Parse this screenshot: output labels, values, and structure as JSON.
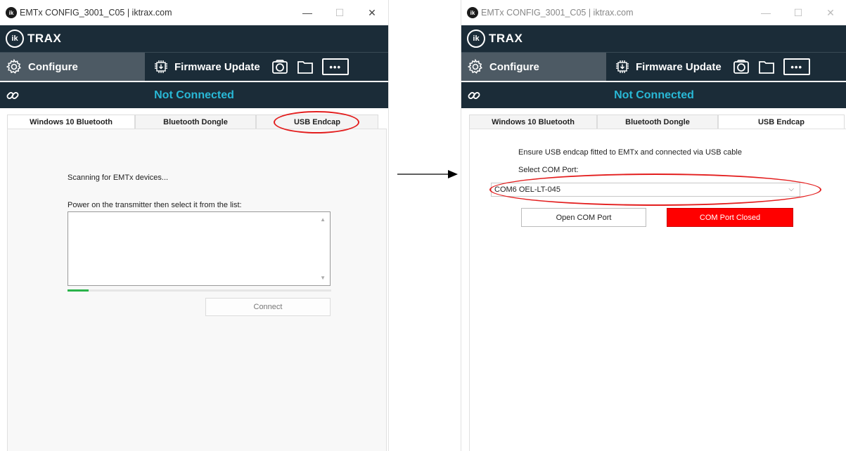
{
  "left_window": {
    "title": "EMTx CONFIG_3001_C05 | iktrax.com",
    "app_icon": "ik",
    "window_controls": {
      "minimize": "—",
      "maximize": "☐",
      "close": "✕"
    },
    "logo": {
      "mark": "ik",
      "text": "TRAX"
    },
    "nav": {
      "configure": "Configure",
      "firmware_update": "Firmware Update",
      "more": "•••"
    },
    "connection_status": "Not Connected",
    "tabs": [
      "Windows 10 Bluetooth",
      "Bluetooth Dongle",
      "USB Endcap"
    ],
    "active_tab": "Windows 10 Bluetooth",
    "scanning_text": "Scanning for EMTx devices...",
    "instruction": "Power on the transmitter then select it from the list:",
    "scan_progress": 0.08,
    "connect_label": "Connect"
  },
  "right_window": {
    "title": "EMTx CONFIG_3001_C05 | iktrax.com",
    "app_icon": "ik",
    "window_controls": {
      "minimize": "—",
      "maximize": "☐",
      "close": "✕"
    },
    "logo": {
      "mark": "ik",
      "text": "TRAX"
    },
    "nav": {
      "configure": "Configure",
      "firmware_update": "Firmware Update",
      "more": "•••"
    },
    "connection_status": "Not Connected",
    "tabs": [
      "Windows 10 Bluetooth",
      "Bluetooth Dongle",
      "USB Endcap"
    ],
    "active_tab": "USB Endcap",
    "ensure_text": "Ensure USB endcap fitted to EMTx and connected via USB cable",
    "select_label": "Select COM Port:",
    "com_port_value": "COM6 OEL-LT-045",
    "open_button": "Open COM Port",
    "status_button": "COM Port Closed"
  },
  "colors": {
    "header_bg": "#1b2c38",
    "configure_bg": "#4d5a64",
    "status_cyan": "#29b8d6",
    "annotation_red": "#e31e1e",
    "progress_green": "#2ab34a",
    "closed_red": "#ff0000"
  },
  "icons": [
    "app-logo-icon",
    "gear-icon",
    "chip-download-icon",
    "camera-icon",
    "folder-icon",
    "more-icon",
    "link-icon",
    "chevron-down-icon",
    "scroll-up-icon",
    "scroll-down-icon",
    "arrow-right-icon"
  ]
}
